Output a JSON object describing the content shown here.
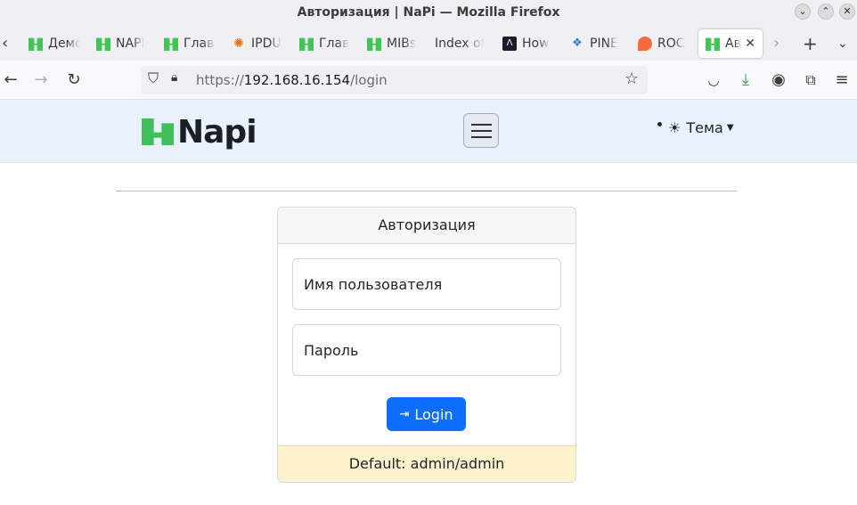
{
  "window": {
    "title": "Авторизация | NaPi — Mozilla Firefox",
    "controls": [
      "minimize",
      "maximize",
      "close"
    ]
  },
  "tabs": [
    {
      "label": "Демо",
      "icon": "napi-icon"
    },
    {
      "label": "NAPI",
      "icon": "napi-icon"
    },
    {
      "label": "Главн",
      "icon": "napi-icon"
    },
    {
      "label": "IPDU",
      "icon": "grafana-icon"
    },
    {
      "label": "Главн",
      "icon": "napi-icon"
    },
    {
      "label": "MIBs",
      "icon": "napi-icon"
    },
    {
      "label": "Index of",
      "icon": ""
    },
    {
      "label": "How",
      "icon": "dark-logo-icon"
    },
    {
      "label": "PINE",
      "icon": "pine-icon"
    },
    {
      "label": "ROC",
      "icon": "roc-icon"
    },
    {
      "label": "Авт",
      "icon": "napi-icon",
      "active": true
    }
  ],
  "urlbar": {
    "scheme": "https://",
    "host": "192.168.16.154",
    "path": "/login"
  },
  "site": {
    "brand": "Napi",
    "theme_label": "Тема"
  },
  "login": {
    "header": "Авторизация",
    "username_placeholder": "Имя пользователя",
    "password_placeholder": "Пароль",
    "button_label": "Login",
    "footer": "Default: admin/admin"
  },
  "colors": {
    "accent": "#0d6efd",
    "navbar_bg": "#e8f1fd",
    "brand_green": "#3fc05a",
    "footer_bg": "#fdf2cc"
  }
}
